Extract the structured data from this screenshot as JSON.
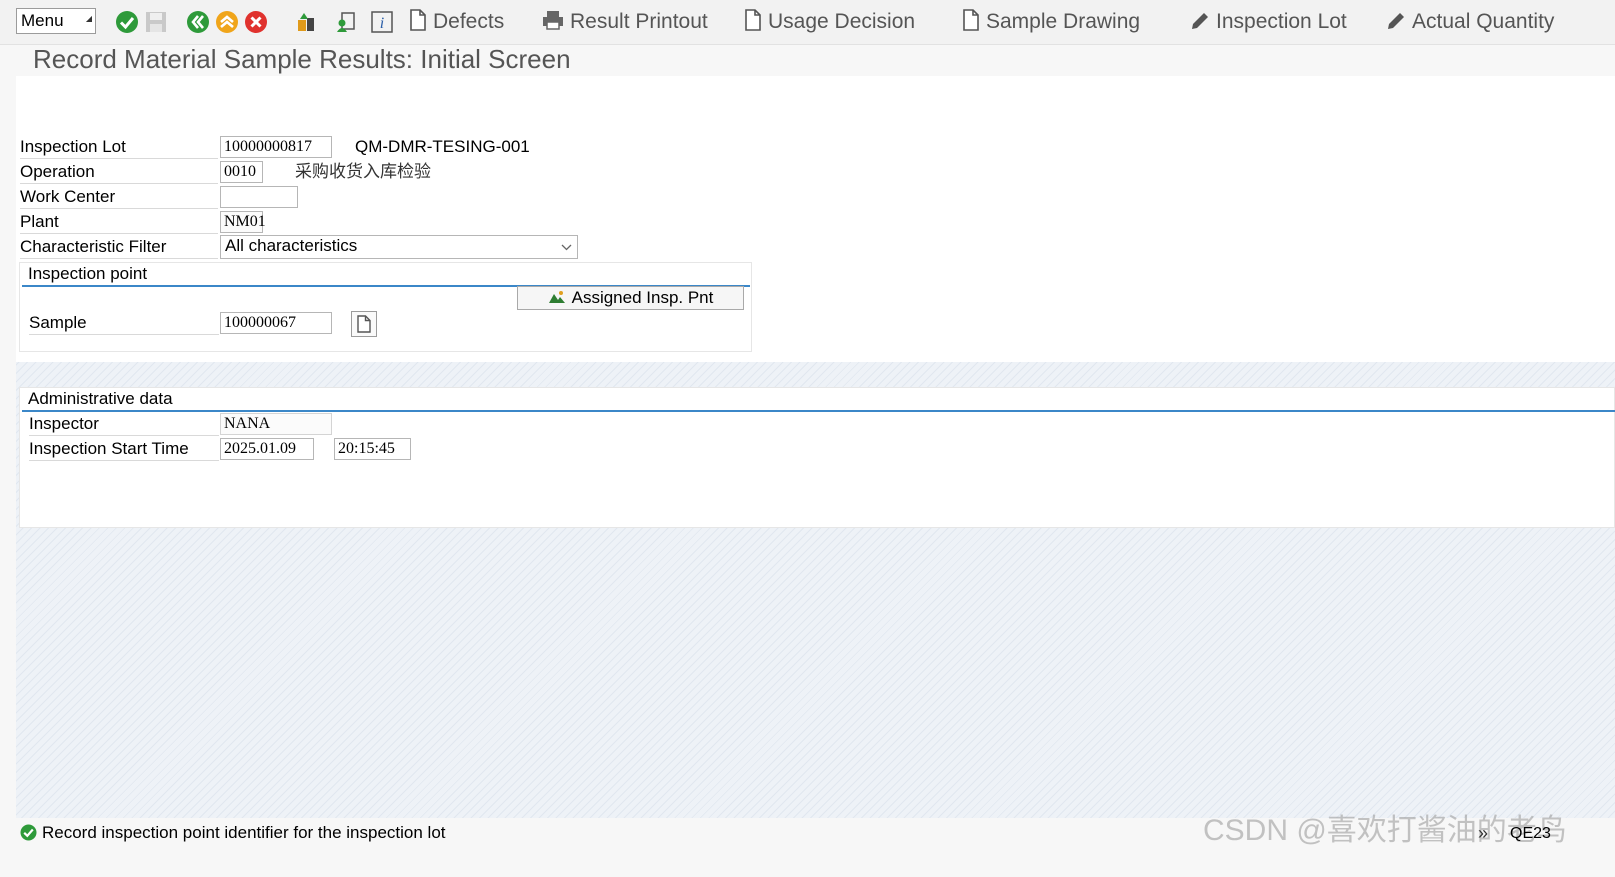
{
  "toolbar": {
    "menu_label": "Menu",
    "buttons": [
      {
        "label": "Defects",
        "icon": "document-icon"
      },
      {
        "label": "Result Printout",
        "icon": "printer-icon"
      },
      {
        "label": "Usage Decision",
        "icon": "document-icon"
      },
      {
        "label": "Sample Drawing",
        "icon": "document-icon"
      },
      {
        "label": "Inspection Lot",
        "icon": "pencil-icon"
      },
      {
        "label": "Actual Quantity",
        "icon": "pencil-icon"
      }
    ]
  },
  "page": {
    "title": "Record Material Sample Results: Initial Screen"
  },
  "form": {
    "inspection_lot": {
      "label": "Inspection Lot",
      "value": "10000000817",
      "description": "QM-DMR-TESING-001"
    },
    "operation": {
      "label": "Operation",
      "value": "0010",
      "description": "采购收货入库检验"
    },
    "work_center": {
      "label": "Work Center",
      "value": ""
    },
    "plant": {
      "label": "Plant",
      "value": "NM01"
    },
    "characteristic_filter": {
      "label": "Characteristic Filter",
      "value": "All characteristics"
    }
  },
  "inspection_point": {
    "title": "Inspection point",
    "assigned_button": "Assigned Insp. Pnt",
    "sample": {
      "label": "Sample",
      "value": "100000067"
    }
  },
  "admin": {
    "title": "Administrative data",
    "inspector": {
      "label": "Inspector",
      "value": "NANA"
    },
    "start_time": {
      "label": "Inspection Start Time",
      "date": "2025.01.09",
      "time": "20:15:45"
    }
  },
  "status": {
    "message": "Record inspection point identifier for the inspection lot",
    "tcode": "QE23"
  },
  "watermark": "CSDN @喜欢打酱油的老鸟",
  "colors": {
    "accent_blue": "#3b87c8",
    "success_green": "#2e9a3a",
    "cancel_red": "#e0322e",
    "exit_orange": "#f0a51a"
  }
}
